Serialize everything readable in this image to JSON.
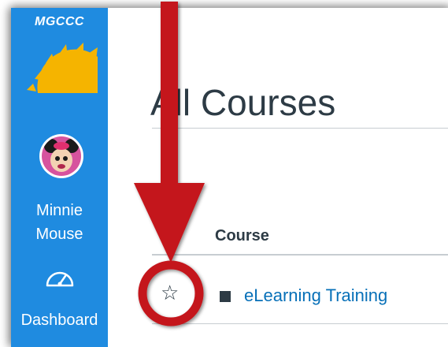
{
  "brand": {
    "name": "MGCCC",
    "sun_color": "#f5b400"
  },
  "sidebar": {
    "background": "#1f8be0",
    "user": {
      "first_name": "Minnie",
      "last_name": "Mouse"
    },
    "items": [
      {
        "label": "Dashboard",
        "icon": "dashboard-gauge-icon"
      }
    ]
  },
  "main": {
    "title": "All Courses",
    "table": {
      "columns": [
        "Course"
      ],
      "rows": [
        {
          "favorite_icon": "star-outline-icon",
          "color": "#2d3b45",
          "course": "eLearning Training"
        }
      ]
    }
  },
  "annotation": {
    "color": "#c4161c",
    "arrow": "down-arrow",
    "highlight": "circle"
  }
}
